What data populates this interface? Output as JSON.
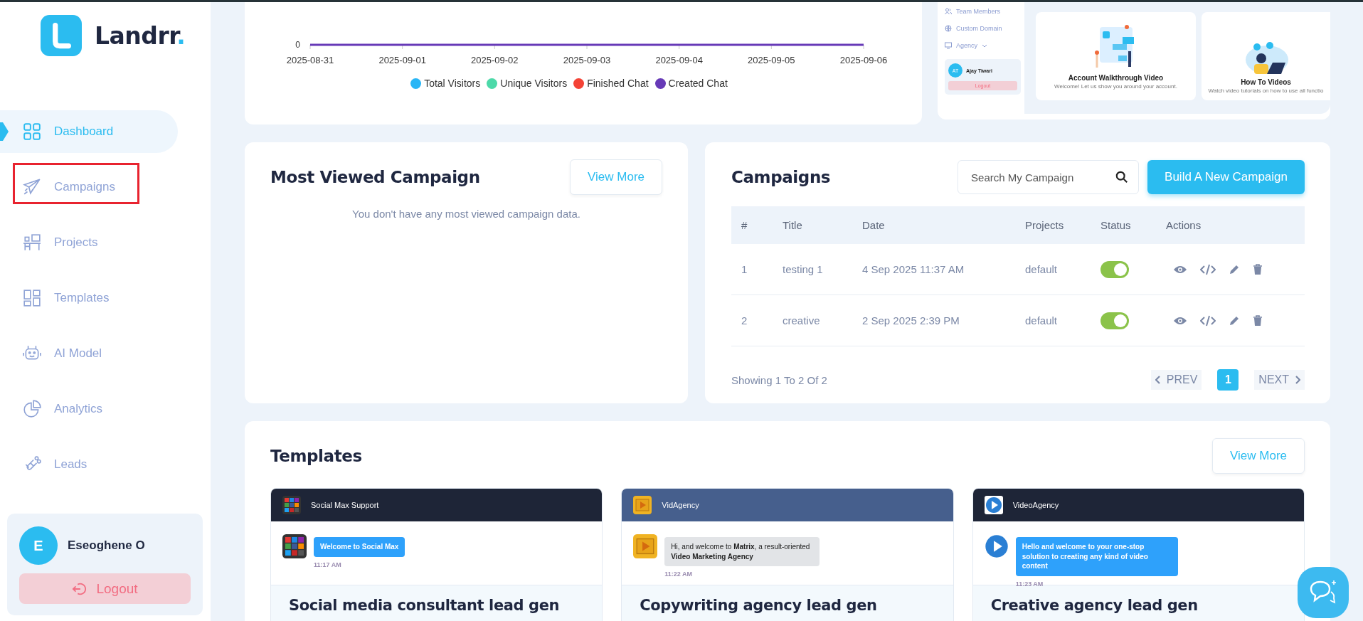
{
  "brand": {
    "name": "Landrr",
    "suffix": "."
  },
  "sidebar": {
    "items": [
      {
        "label": "Dashboard",
        "selected": true,
        "highlighted": false
      },
      {
        "label": "Campaigns",
        "selected": false,
        "highlighted": true
      },
      {
        "label": "Projects",
        "selected": false,
        "highlighted": false
      },
      {
        "label": "Templates",
        "selected": false,
        "highlighted": false
      },
      {
        "label": "AI Model",
        "selected": false,
        "highlighted": false
      },
      {
        "label": "Analytics",
        "selected": false,
        "highlighted": false
      },
      {
        "label": "Leads",
        "selected": false,
        "highlighted": false
      }
    ]
  },
  "user": {
    "initial": "E",
    "name": "Eseoghene O",
    "logout": "Logout"
  },
  "chart": {
    "zero_label": "0",
    "x_labels": [
      "2025-08-31",
      "2025-09-01",
      "2025-09-02",
      "2025-09-03",
      "2025-09-04",
      "2025-09-05",
      "2025-09-06"
    ],
    "legend": [
      {
        "name": "Total Visitors",
        "color": "#29b6f6"
      },
      {
        "name": "Unique Visitors",
        "color": "#4dd9a9"
      },
      {
        "name": "Finished Chat",
        "color": "#f44336"
      },
      {
        "name": "Created Chat",
        "color": "#673ab7"
      }
    ]
  },
  "video_panel": {
    "mini_sidebar": {
      "items": [
        "Team Members",
        "Custom Domain",
        "Agency"
      ],
      "user": {
        "initials": "AT",
        "name": "Ajay Tiwari",
        "logout": "Logout"
      }
    },
    "cards": [
      {
        "title": "Account Walkthrough Video",
        "description": "Welcome! Let us show you around your account."
      },
      {
        "title": "How To Videos",
        "description": "Watch video tutorials on how to use all functio"
      }
    ]
  },
  "most_viewed": {
    "title": "Most Viewed Campaign",
    "button": "View More",
    "empty_message": "You don't have any most viewed campaign data."
  },
  "campaigns": {
    "title": "Campaigns",
    "search": {
      "placeholder": "Search My Campaign"
    },
    "button": "Build A New Campaign",
    "columns": [
      "#",
      "Title",
      "Date",
      "Projects",
      "Status",
      "Actions"
    ],
    "rows": [
      {
        "number": "1",
        "title": "testing 1",
        "date": "4 Sep 2025 11:37 AM",
        "project": "default",
        "on": true
      },
      {
        "number": "2",
        "title": "creative",
        "date": "2 Sep 2025 2:39 PM",
        "project": "default",
        "on": true
      }
    ],
    "footer": "Showing 1 To 2 Of 2",
    "pagination": {
      "prev": "PREV",
      "pages": [
        {
          "label": "1",
          "selected": true
        }
      ],
      "next": "NEXT"
    }
  },
  "templates": {
    "title": "Templates",
    "button": "View More",
    "items": [
      {
        "bot_name": "Social Max Support",
        "message": "Welcome to Social Max",
        "time": "11:17 AM",
        "title": "Social media consultant lead gen"
      },
      {
        "bot_name": "VidAgency",
        "message": "Hi, and welcome to **Matrix**, a result-oriented **Video Marketing Agency**",
        "time": "11:22 AM",
        "title": "Copywriting agency lead gen"
      },
      {
        "bot_name": "VideoAgency",
        "message": "Hello and welcome to your one-stop solution to creating any kind of video content",
        "time": "11:23 AM",
        "title": "Creative agency lead gen"
      }
    ]
  }
}
